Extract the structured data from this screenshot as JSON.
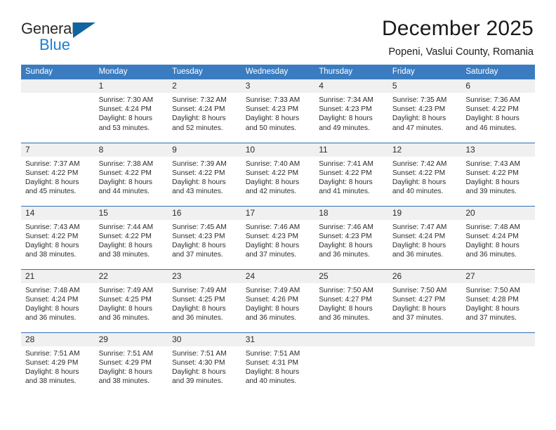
{
  "brand": {
    "line1": "General",
    "line2": "Blue",
    "accent_blue": "#1b7fd4",
    "triangle_blue": "#10659f"
  },
  "header": {
    "title": "December 2025",
    "subtitle": "Popeni, Vaslui County, Romania"
  },
  "calendar": {
    "header_bg": "#3b7cc0",
    "daynum_bg": "#f0f0f0",
    "weekday_headers": [
      "Sunday",
      "Monday",
      "Tuesday",
      "Wednesday",
      "Thursday",
      "Friday",
      "Saturday"
    ],
    "weeks": [
      [
        {
          "day": "",
          "lines": []
        },
        {
          "day": "1",
          "lines": [
            "Sunrise: 7:30 AM",
            "Sunset: 4:24 PM",
            "Daylight: 8 hours",
            "and 53 minutes."
          ]
        },
        {
          "day": "2",
          "lines": [
            "Sunrise: 7:32 AM",
            "Sunset: 4:24 PM",
            "Daylight: 8 hours",
            "and 52 minutes."
          ]
        },
        {
          "day": "3",
          "lines": [
            "Sunrise: 7:33 AM",
            "Sunset: 4:23 PM",
            "Daylight: 8 hours",
            "and 50 minutes."
          ]
        },
        {
          "day": "4",
          "lines": [
            "Sunrise: 7:34 AM",
            "Sunset: 4:23 PM",
            "Daylight: 8 hours",
            "and 49 minutes."
          ]
        },
        {
          "day": "5",
          "lines": [
            "Sunrise: 7:35 AM",
            "Sunset: 4:23 PM",
            "Daylight: 8 hours",
            "and 47 minutes."
          ]
        },
        {
          "day": "6",
          "lines": [
            "Sunrise: 7:36 AM",
            "Sunset: 4:22 PM",
            "Daylight: 8 hours",
            "and 46 minutes."
          ]
        }
      ],
      [
        {
          "day": "7",
          "lines": [
            "Sunrise: 7:37 AM",
            "Sunset: 4:22 PM",
            "Daylight: 8 hours",
            "and 45 minutes."
          ]
        },
        {
          "day": "8",
          "lines": [
            "Sunrise: 7:38 AM",
            "Sunset: 4:22 PM",
            "Daylight: 8 hours",
            "and 44 minutes."
          ]
        },
        {
          "day": "9",
          "lines": [
            "Sunrise: 7:39 AM",
            "Sunset: 4:22 PM",
            "Daylight: 8 hours",
            "and 43 minutes."
          ]
        },
        {
          "day": "10",
          "lines": [
            "Sunrise: 7:40 AM",
            "Sunset: 4:22 PM",
            "Daylight: 8 hours",
            "and 42 minutes."
          ]
        },
        {
          "day": "11",
          "lines": [
            "Sunrise: 7:41 AM",
            "Sunset: 4:22 PM",
            "Daylight: 8 hours",
            "and 41 minutes."
          ]
        },
        {
          "day": "12",
          "lines": [
            "Sunrise: 7:42 AM",
            "Sunset: 4:22 PM",
            "Daylight: 8 hours",
            "and 40 minutes."
          ]
        },
        {
          "day": "13",
          "lines": [
            "Sunrise: 7:43 AM",
            "Sunset: 4:22 PM",
            "Daylight: 8 hours",
            "and 39 minutes."
          ]
        }
      ],
      [
        {
          "day": "14",
          "lines": [
            "Sunrise: 7:43 AM",
            "Sunset: 4:22 PM",
            "Daylight: 8 hours",
            "and 38 minutes."
          ]
        },
        {
          "day": "15",
          "lines": [
            "Sunrise: 7:44 AM",
            "Sunset: 4:22 PM",
            "Daylight: 8 hours",
            "and 38 minutes."
          ]
        },
        {
          "day": "16",
          "lines": [
            "Sunrise: 7:45 AM",
            "Sunset: 4:23 PM",
            "Daylight: 8 hours",
            "and 37 minutes."
          ]
        },
        {
          "day": "17",
          "lines": [
            "Sunrise: 7:46 AM",
            "Sunset: 4:23 PM",
            "Daylight: 8 hours",
            "and 37 minutes."
          ]
        },
        {
          "day": "18",
          "lines": [
            "Sunrise: 7:46 AM",
            "Sunset: 4:23 PM",
            "Daylight: 8 hours",
            "and 36 minutes."
          ]
        },
        {
          "day": "19",
          "lines": [
            "Sunrise: 7:47 AM",
            "Sunset: 4:24 PM",
            "Daylight: 8 hours",
            "and 36 minutes."
          ]
        },
        {
          "day": "20",
          "lines": [
            "Sunrise: 7:48 AM",
            "Sunset: 4:24 PM",
            "Daylight: 8 hours",
            "and 36 minutes."
          ]
        }
      ],
      [
        {
          "day": "21",
          "lines": [
            "Sunrise: 7:48 AM",
            "Sunset: 4:24 PM",
            "Daylight: 8 hours",
            "and 36 minutes."
          ]
        },
        {
          "day": "22",
          "lines": [
            "Sunrise: 7:49 AM",
            "Sunset: 4:25 PM",
            "Daylight: 8 hours",
            "and 36 minutes."
          ]
        },
        {
          "day": "23",
          "lines": [
            "Sunrise: 7:49 AM",
            "Sunset: 4:25 PM",
            "Daylight: 8 hours",
            "and 36 minutes."
          ]
        },
        {
          "day": "24",
          "lines": [
            "Sunrise: 7:49 AM",
            "Sunset: 4:26 PM",
            "Daylight: 8 hours",
            "and 36 minutes."
          ]
        },
        {
          "day": "25",
          "lines": [
            "Sunrise: 7:50 AM",
            "Sunset: 4:27 PM",
            "Daylight: 8 hours",
            "and 36 minutes."
          ]
        },
        {
          "day": "26",
          "lines": [
            "Sunrise: 7:50 AM",
            "Sunset: 4:27 PM",
            "Daylight: 8 hours",
            "and 37 minutes."
          ]
        },
        {
          "day": "27",
          "lines": [
            "Sunrise: 7:50 AM",
            "Sunset: 4:28 PM",
            "Daylight: 8 hours",
            "and 37 minutes."
          ]
        }
      ],
      [
        {
          "day": "28",
          "lines": [
            "Sunrise: 7:51 AM",
            "Sunset: 4:29 PM",
            "Daylight: 8 hours",
            "and 38 minutes."
          ]
        },
        {
          "day": "29",
          "lines": [
            "Sunrise: 7:51 AM",
            "Sunset: 4:29 PM",
            "Daylight: 8 hours",
            "and 38 minutes."
          ]
        },
        {
          "day": "30",
          "lines": [
            "Sunrise: 7:51 AM",
            "Sunset: 4:30 PM",
            "Daylight: 8 hours",
            "and 39 minutes."
          ]
        },
        {
          "day": "31",
          "lines": [
            "Sunrise: 7:51 AM",
            "Sunset: 4:31 PM",
            "Daylight: 8 hours",
            "and 40 minutes."
          ]
        },
        {
          "day": "",
          "lines": []
        },
        {
          "day": "",
          "lines": []
        },
        {
          "day": "",
          "lines": []
        }
      ]
    ]
  }
}
